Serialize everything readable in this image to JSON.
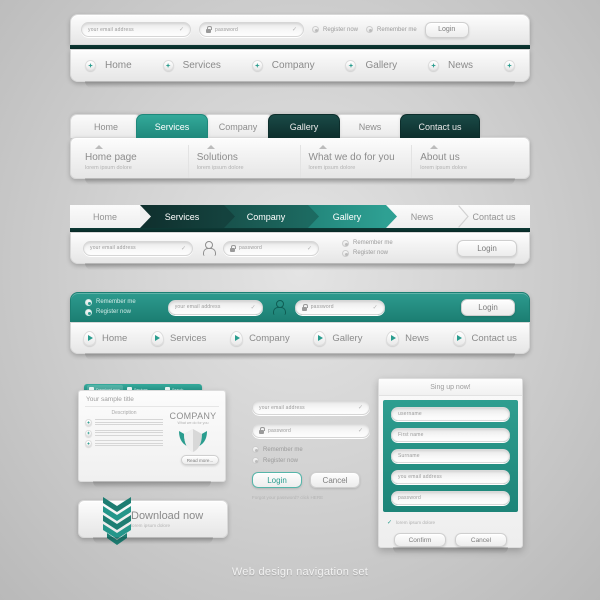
{
  "caption": "Web design navigation set",
  "colors": {
    "teal": "#2a9d8f",
    "teal_dark": "#1d8478",
    "dark": "#0d2e2c",
    "bar_light": "#f3f3f3",
    "text_grey": "#8b8b8b"
  },
  "block1": {
    "email_placeholder": "your email address",
    "password_placeholder": "password",
    "register": "Register now",
    "remember": "Remember me",
    "login": "Login",
    "nav": [
      {
        "label": "Home"
      },
      {
        "label": "Services"
      },
      {
        "label": "Company"
      },
      {
        "label": "Gallery"
      },
      {
        "label": "News"
      }
    ]
  },
  "block2": {
    "tabs": [
      {
        "label": "Home",
        "style": "light"
      },
      {
        "label": "Services",
        "style": "teal"
      },
      {
        "label": "Company",
        "style": "light"
      },
      {
        "label": "Gallery",
        "style": "dark"
      },
      {
        "label": "News",
        "style": "light"
      },
      {
        "label": "Contact us",
        "style": "dark"
      }
    ],
    "columns": [
      {
        "title": "Home page",
        "sub": "lorem ipsum dolore"
      },
      {
        "title": "Solutions",
        "sub": "lorem ipsum dolore"
      },
      {
        "title": "What we do for you",
        "sub": "lorem ipsum dolore"
      },
      {
        "title": "About us",
        "sub": "lorem ipsum dolore"
      }
    ]
  },
  "block3": {
    "crumbs": [
      {
        "label": "Home",
        "style": "light"
      },
      {
        "label": "Services",
        "style": "dark"
      },
      {
        "label": "Company",
        "style": "mid"
      },
      {
        "label": "Gallery",
        "style": "teal"
      },
      {
        "label": "News",
        "style": "light"
      },
      {
        "label": "Contact us",
        "style": "light"
      }
    ],
    "email_placeholder": "your email address",
    "password_placeholder": "password",
    "remember": "Remember me",
    "register": "Register now",
    "login": "Login"
  },
  "block4": {
    "remember": "Remember me",
    "register": "Register now",
    "email_placeholder": "your email address",
    "password_placeholder": "password",
    "login": "Login",
    "nav": [
      {
        "label": "Home"
      },
      {
        "label": "Services"
      },
      {
        "label": "Company"
      },
      {
        "label": "Gallery"
      },
      {
        "label": "News"
      },
      {
        "label": "Contact us"
      }
    ]
  },
  "widget": {
    "tabs": [
      {
        "label": "Download now"
      },
      {
        "label": "Services"
      },
      {
        "label": "Search"
      }
    ],
    "title": "Your sample title",
    "description_heading": "Description",
    "company_name": "COMPANY",
    "company_slogan": "What we do for you",
    "read_more": "Read more..."
  },
  "login_form": {
    "email_placeholder": "your email address",
    "password_placeholder": "password",
    "remember": "Remember me",
    "register": "Register now",
    "login": "Login",
    "cancel": "Cancel",
    "forgot": "Forgot your password? click HERE"
  },
  "signup": {
    "heading": "Sing up now!",
    "fields": [
      {
        "placeholder": "username"
      },
      {
        "placeholder": "First name"
      },
      {
        "placeholder": "Surname"
      },
      {
        "placeholder": "you email address"
      },
      {
        "placeholder": "password"
      }
    ],
    "agree": "lorem ipsum dolore",
    "confirm": "Confirm",
    "cancel": "Cancel"
  },
  "download": {
    "title": "Download now",
    "sub": "lorem ipsum dolore"
  }
}
